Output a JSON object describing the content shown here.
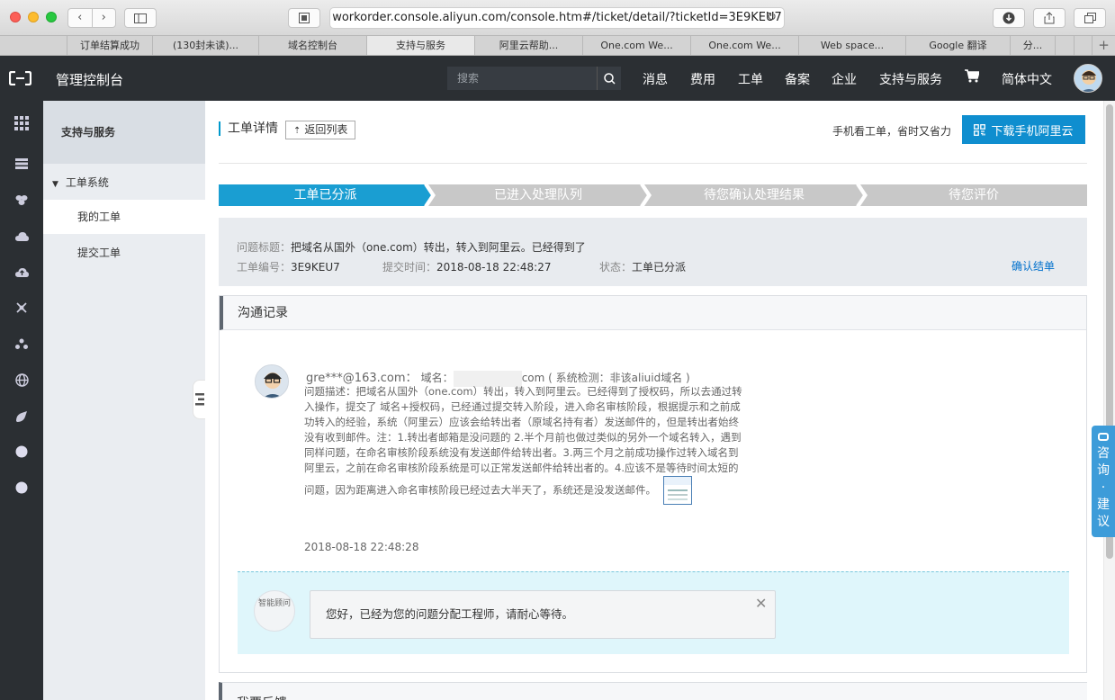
{
  "browser": {
    "url": "workorder.console.aliyun.com/console.htm#/ticket/detail/?ticketId=3E9KEU7",
    "tabs": [
      {
        "label": "订单结算成功"
      },
      {
        "label": "(130封未读)..."
      },
      {
        "label": "域名控制台"
      },
      {
        "label": "支持与服务"
      },
      {
        "label": "阿里云帮助..."
      },
      {
        "label": "One.com We..."
      },
      {
        "label": "One.com We..."
      },
      {
        "label": "Web space..."
      },
      {
        "label": "Google 翻译"
      },
      {
        "label": "分..."
      }
    ]
  },
  "topnav": {
    "title": "管理控制台",
    "search_placeholder": "搜索",
    "items": [
      "消息",
      "费用",
      "工单",
      "备案",
      "企业",
      "支持与服务"
    ],
    "language": "简体中文"
  },
  "sidebar": {
    "title": "支持与服务",
    "group": "工单系统",
    "items": [
      "我的工单",
      "提交工单"
    ]
  },
  "header": {
    "title": "工单详情",
    "back_label": "返回列表",
    "mobile_hint": "手机看工单，省时又省力",
    "download_label": "下载手机阿里云"
  },
  "steps": [
    "工单已分派",
    "已进入处理队列",
    "待您确认处理结果",
    "待您评价"
  ],
  "ticket": {
    "subject_label": "问题标题：",
    "subject": "把域名从国外（one.com）转出，转入到阿里云。已经得到了",
    "id_label": "工单编号：",
    "id": "3E9KEU7",
    "time_label": "提交时间：",
    "time": "2018-08-18 22:48:27",
    "status_label": "状态：",
    "status": "工单已分派",
    "confirm_label": "确认结单"
  },
  "communication": {
    "title": "沟通记录",
    "message": {
      "user": "gre***@163.com：",
      "domain_label": "域名：",
      "domain_suffix": "com ( 系统检测：非该aliuid域名 )",
      "desc_label": "问题描述：",
      "desc": "把域名从国外（one.com）转出，转入到阿里云。已经得到了授权码，所以去通过转入操作，提交了 域名+授权码，已经通过提交转入阶段，进入命名审核阶段，根据提示和之前成功转入的经验，系统（阿里云）应该会给转出者（原域名持有者）发送邮件的，但是转出者始终没有收到邮件。注：1.转出者邮箱是没问题的 2.半个月前也做过类似的另外一个域名转入，遇到同样问题，在命名审核阶段系统没有发送邮件给转出者。3.两三个月之前成功操作过转入域名到阿里云，之前在命名审核阶段系统是可以正常发送邮件给转出者的。4.应该不是等待时间太短的问题，因为距离进入命名审核阶段已经过去大半天了，系统还是没发送邮件。",
      "time": "2018-08-18 22:48:28"
    },
    "assistant": {
      "name": "智能顾问",
      "text": "您好，已经为您的问题分配工程师，请耐心等待。"
    }
  },
  "feedback": {
    "title": "我要反馈"
  },
  "consult": {
    "label": "咨询·建议"
  },
  "colors": {
    "accent": "#0f8ecf",
    "step_active": "#1a9ed2",
    "step_inactive": "#c8c8c8",
    "topbar": "#2b2f33"
  }
}
